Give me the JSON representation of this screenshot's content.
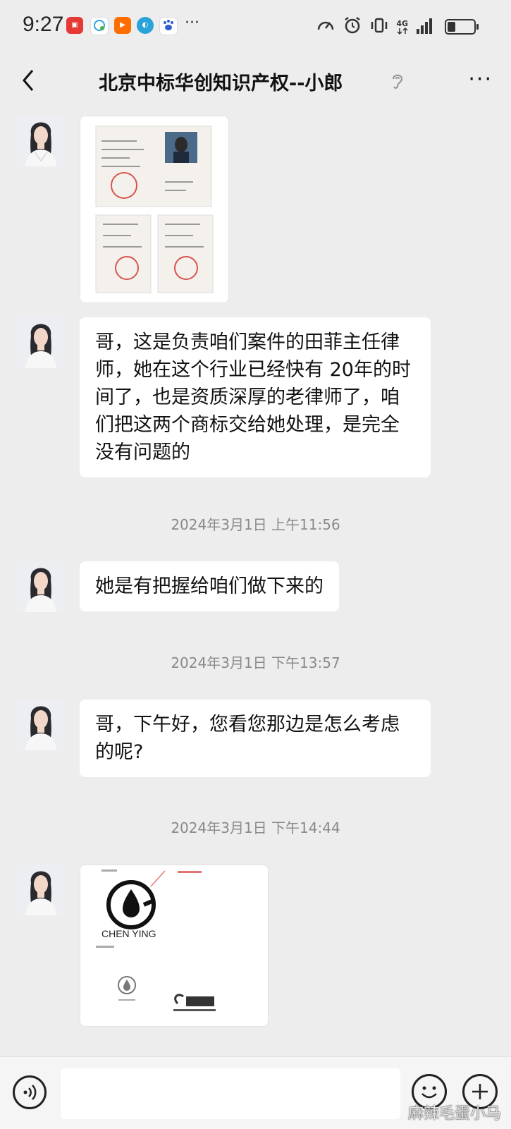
{
  "status_bar": {
    "time": "9:27",
    "network_label": "4G",
    "battery_level": 0.3,
    "app_icons": [
      {
        "name": "news-app-icon",
        "color": "#e53935"
      },
      {
        "name": "chat-app-icon",
        "color": "#ffffff"
      },
      {
        "name": "video-app-icon",
        "color": "#ff6d00"
      },
      {
        "name": "browser-app-icon",
        "color": "#29a3d8"
      },
      {
        "name": "baidu-app-icon",
        "color": "#ffffff"
      }
    ],
    "more_label": "···"
  },
  "header": {
    "back_icon": "chevron-left-icon",
    "title": "北京中标华创知识产权--小郎",
    "ear_icon": "ear-icon",
    "more_label": "···"
  },
  "messages": [
    {
      "type": "image",
      "content": "lawyer-license-photo"
    },
    {
      "type": "text",
      "text": "哥，这是负责咱们案件的田菲主任律师，她在这个行业已经快有 20年的时间了，也是资质深厚的老律师了，咱们把这两个商标交给她处理，是完全没有问题的"
    },
    {
      "type": "timestamp",
      "text": "2024年3月1日 上午11:56"
    },
    {
      "type": "text",
      "text": "她是有把握给咱们做下来的"
    },
    {
      "type": "timestamp",
      "text": "2024年3月1日 下午13:57"
    },
    {
      "type": "text",
      "text": "哥，下午好，您看您那边是怎么考虑的呢?"
    },
    {
      "type": "timestamp",
      "text": "2024年3月1日 下午14:44"
    },
    {
      "type": "image",
      "content": "trademark-image",
      "caption": "CHEN YING"
    }
  ],
  "input_bar": {
    "voice_icon": "voice-icon",
    "text_value": "",
    "emoji_icon": "emoji-icon",
    "plus_icon": "plus-icon"
  },
  "watermark": "麻辣毛蛋小马",
  "colors": {
    "background": "#ededed",
    "bubble": "#ffffff",
    "timestamp": "#8a8a8a"
  }
}
